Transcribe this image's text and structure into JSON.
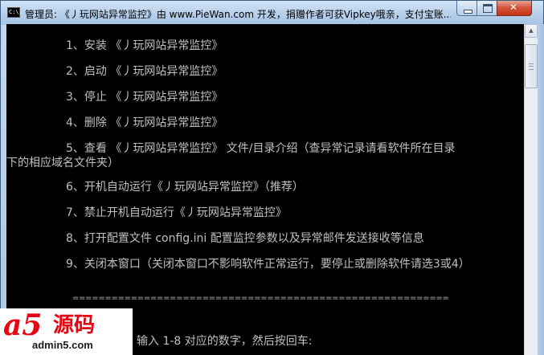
{
  "window": {
    "title": "管理员: 《丿玩网站异常监控》由 www.PieWan.com 开发，捐赠作者可获Vipkey哦亲，支付宝账...",
    "icon": "console-icon",
    "icon_text": "C:\\."
  },
  "console": {
    "lines": [
      "1、安装 《丿玩网站异常监控》",
      "2、启动 《丿玩网站异常监控》",
      "3、停止 《丿玩网站异常监控》",
      "4、删除 《丿玩网站异常监控》",
      "5、查看 《丿玩网站异常监控》 文件/目录介绍（查异常记录请看软件所在目录",
      "下的相应域名文件夹）",
      "6、开机自动运行《丿玩网站异常监控》（推荐）",
      "7、禁止开机自动运行《丿玩网站异常监控》",
      "8、打开配置文件 config.ini 配置监控参数以及异常邮件发送接收等信息",
      "9、关闭本窗口（关闭本窗口不影响软件正常运行，要停止或删除软件请选3或4）",
      "==========================================================",
      "输入 1-8 对应的数字，然后按回车:"
    ]
  },
  "watermark": {
    "logo": "a5",
    "name": "源码",
    "url": "admin5.com"
  },
  "colors": {
    "console_bg": "#000000",
    "console_text": "#c0c0c0",
    "close_button": "#c33418",
    "watermark_red": "#e30613"
  }
}
